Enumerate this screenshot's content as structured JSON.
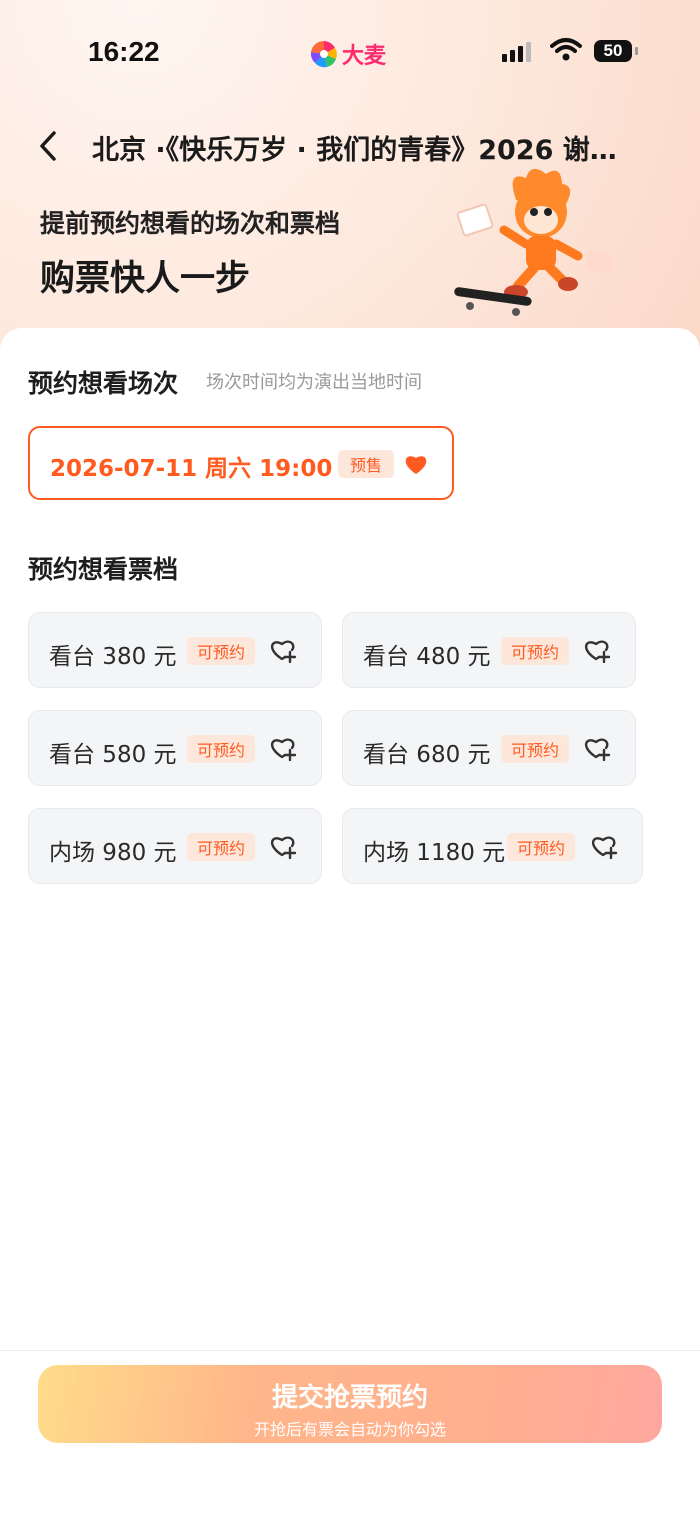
{
  "status_bar": {
    "time": "16:22",
    "brand": "大麦",
    "battery": "50"
  },
  "nav": {
    "title": "北京 ·《快乐万岁 · 我们的青春》2026 谢…"
  },
  "promo": {
    "line1": "提前预约想看的场次和票档",
    "line2": "购票快人一步"
  },
  "sessions_section": {
    "title": "预约想看场次",
    "subtitle": "场次时间均为演出当地时间",
    "selected": {
      "label": "2026-07-11  周六 19:00",
      "badge": "预售"
    }
  },
  "tiers_section": {
    "title": "预约想看票档",
    "tiers": [
      {
        "label": "看台 380 元",
        "badge": "可预约"
      },
      {
        "label": "看台 480 元",
        "badge": "可预约"
      },
      {
        "label": "看台 580 元",
        "badge": "可预约"
      },
      {
        "label": "看台 680 元",
        "badge": "可预约"
      },
      {
        "label": "内场 980 元",
        "badge": "可预约"
      },
      {
        "label": "内场 1180 元",
        "badge": "可预约"
      }
    ]
  },
  "submit": {
    "label": "提交抢票预约",
    "hint": "开抢后有票会自动为你勾选"
  },
  "colors": {
    "accent": "#ff5a1f",
    "badge_bg": "#fde7db",
    "brand": "#ff2a6d"
  }
}
